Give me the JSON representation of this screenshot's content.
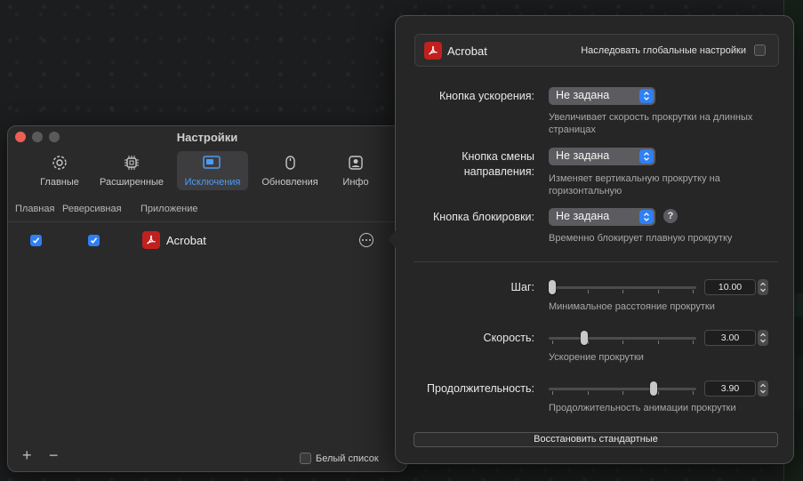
{
  "window": {
    "title": "Настройки",
    "tabs": [
      {
        "label": "Главные",
        "icon": "gear-icon"
      },
      {
        "label": "Расширенные",
        "icon": "chip-icon"
      },
      {
        "label": "Исключения",
        "icon": "windows-icon",
        "active": true
      },
      {
        "label": "Обновления",
        "icon": "mouse-refresh-icon"
      },
      {
        "label": "Инфо",
        "icon": "person-icon"
      }
    ],
    "columns": {
      "main": "Плавная",
      "reverse": "Реверсивная",
      "app": "Приложение"
    },
    "rows": [
      {
        "main_checked": true,
        "reverse_checked": true,
        "app": "Acrobat",
        "icon": "acrobat-icon"
      }
    ],
    "bottom": {
      "add": "+",
      "remove": "−",
      "whitelist_label": "Белый список",
      "whitelist_checked": false
    }
  },
  "popover": {
    "app_name": "Acrobat",
    "inherit_label": "Наследовать глобальные настройки",
    "inherit_checked": false,
    "hotkeys": [
      {
        "label": "Кнопка ускорения:",
        "value": "Не задана",
        "hint": "Увеличивает скорость прокрутки на длинных страницах"
      },
      {
        "label": "Кнопка смены направления:",
        "value": "Не задана",
        "hint": "Изменяет вертикальную прокрутку на горизонтальную"
      },
      {
        "label": "Кнопка блокировки:",
        "value": "Не задана",
        "hint": "Временно блокирует плавную прокрутку",
        "help": "?"
      }
    ],
    "sliders": [
      {
        "label": "Шаг:",
        "value": "10.00",
        "level": 0.0,
        "hint": "Минимальное расстояние прокрутки"
      },
      {
        "label": "Скорость:",
        "value": "3.00",
        "level": 0.23,
        "hint": "Ускорение прокрутки"
      },
      {
        "label": "Продолжительность:",
        "value": "3.90",
        "level": 0.72,
        "hint": "Продолжительность анимации прокрутки"
      }
    ],
    "restore_label": "Восстановить стандартные"
  },
  "colors": {
    "accent": "#2f7ff5",
    "acrobat_red": "#c2201f",
    "active_tab_text": "#4d9bf5"
  }
}
